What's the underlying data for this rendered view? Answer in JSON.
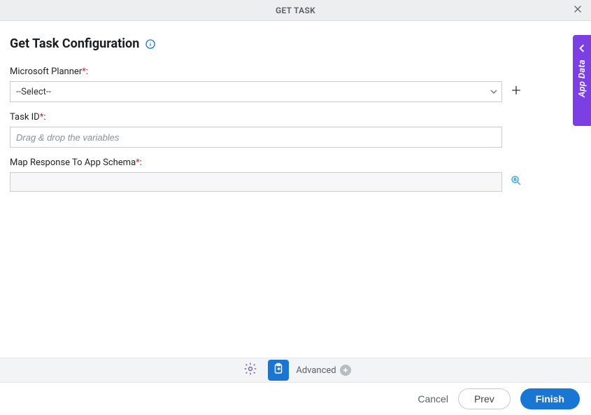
{
  "header": {
    "title": "GET TASK"
  },
  "page": {
    "title": "Get Task Configuration"
  },
  "fields": {
    "planner": {
      "label": "Microsoft Planner",
      "required_marker": "*",
      "colon": ":",
      "selected": "--Select--"
    },
    "task_id": {
      "label": "Task ID",
      "required_marker": "*",
      "colon": ":",
      "placeholder": "Drag & drop the variables"
    },
    "map_response": {
      "label": "Map Response To App Schema",
      "required_marker": "*",
      "colon": ":"
    }
  },
  "side_tab": {
    "label": "App Data"
  },
  "toolbar": {
    "advanced_label": "Advanced"
  },
  "footer": {
    "cancel": "Cancel",
    "prev": "Prev",
    "finish": "Finish"
  }
}
